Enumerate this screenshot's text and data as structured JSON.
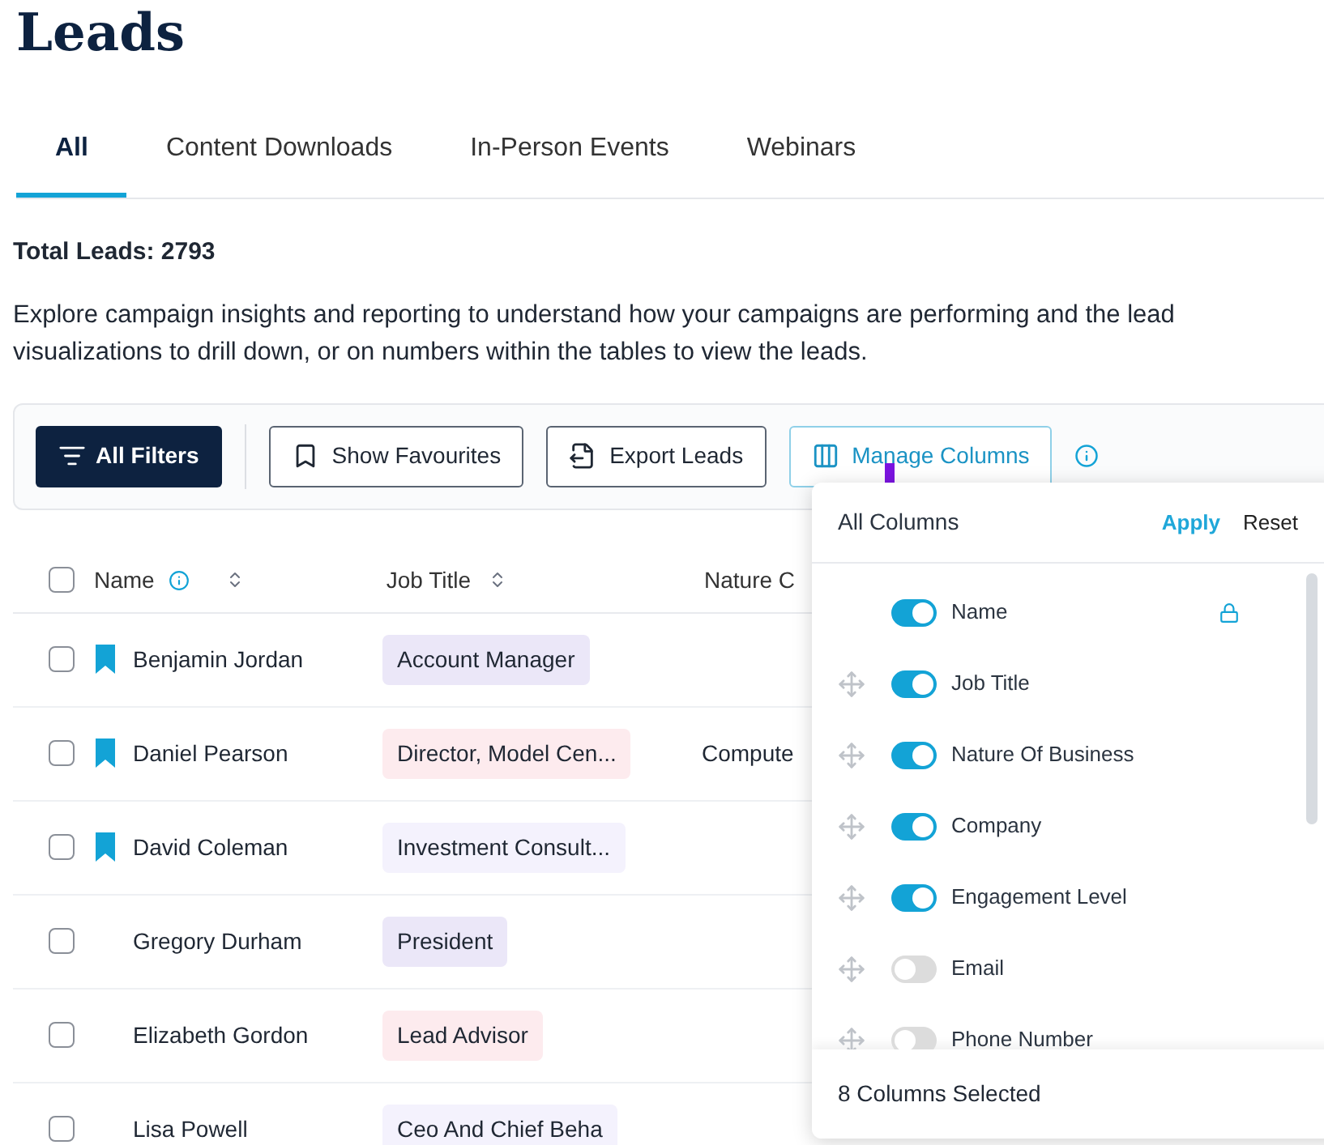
{
  "page": {
    "title": "Leads"
  },
  "tabs": [
    {
      "label": "All",
      "selected": true
    },
    {
      "label": "Content Downloads",
      "selected": false
    },
    {
      "label": "In-Person Events",
      "selected": false
    },
    {
      "label": "Webinars",
      "selected": false
    }
  ],
  "summary": {
    "total": "Total Leads: 2793",
    "description_lines": [
      "Explore campaign insights and reporting to understand how your campaigns are performing and the lead",
      "visualizations to drill down, or on numbers within the tables to view the leads."
    ]
  },
  "toolbar": {
    "all_filters": "All Filters",
    "show_favourites": "Show Favourites",
    "export_leads": "Export Leads",
    "manage_columns": "Manage Columns"
  },
  "table": {
    "select_all_checked": false,
    "columns": [
      "Name",
      "Job Title",
      "Nature C"
    ],
    "rows": [
      {
        "name": "Benjamin Jordan",
        "bookmarked": true,
        "checked": false,
        "job_title": "Account Manager",
        "color": "#ebe7f8",
        "nature": ""
      },
      {
        "name": "Daniel Pearson",
        "bookmarked": true,
        "checked": false,
        "job_title": "Director, Model Cen...",
        "color": "#fdebee",
        "nature": "Compute"
      },
      {
        "name": "David Coleman",
        "bookmarked": true,
        "checked": false,
        "job_title": "Investment Consult...",
        "color": "#f4f2fd",
        "nature": ""
      },
      {
        "name": "Gregory Durham",
        "bookmarked": false,
        "checked": false,
        "job_title": "President",
        "color": "#ebe7f8",
        "nature": ""
      },
      {
        "name": "Elizabeth Gordon",
        "bookmarked": false,
        "checked": false,
        "job_title": "Lead Advisor",
        "color": "#fdebee",
        "nature": ""
      },
      {
        "name": "Lisa Powell",
        "bookmarked": false,
        "checked": false,
        "job_title": "Ceo And Chief Beha",
        "color": "#f4f2fd",
        "nature": ""
      }
    ]
  },
  "column_panel": {
    "title": "All Columns",
    "apply": "Apply",
    "reset": "Reset",
    "footer": "8 Columns Selected",
    "items": [
      {
        "label": "Name",
        "on": true,
        "locked": true
      },
      {
        "label": "Job Title",
        "on": true,
        "locked": false
      },
      {
        "label": "Nature Of Business",
        "on": true,
        "locked": false
      },
      {
        "label": "Company",
        "on": true,
        "locked": false
      },
      {
        "label": "Engagement Level",
        "on": true,
        "locked": false
      },
      {
        "label": "Email",
        "on": false,
        "locked": false
      },
      {
        "label": "Phone Number",
        "on": false,
        "locked": false
      }
    ]
  }
}
